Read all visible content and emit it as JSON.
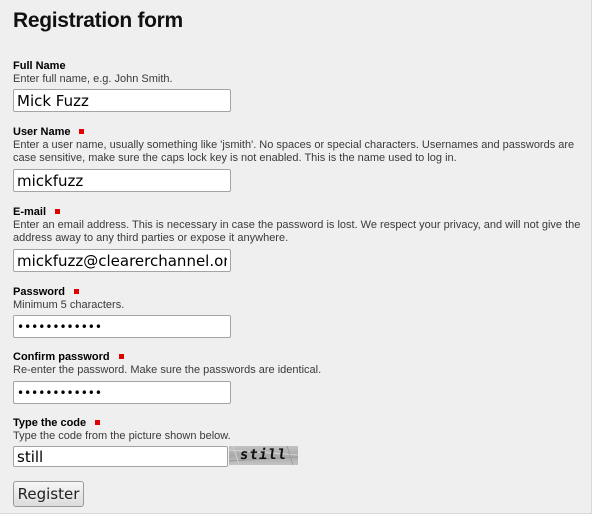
{
  "form": {
    "title": "Registration form",
    "required_marker_color": "#e00000",
    "fields": {
      "full_name": {
        "label": "Full Name",
        "hint": "Enter full name, e.g. John Smith.",
        "value": "Mick Fuzz"
      },
      "user_name": {
        "label": "User Name",
        "hint": "Enter a user name, usually something like 'jsmith'. No spaces or special characters. Usernames and passwords are case sensitive, make sure the caps lock key is not enabled. This is the name used to log in.",
        "value": "mickfuzz"
      },
      "email": {
        "label": "E-mail",
        "hint": "Enter an email address. This is necessary in case the password is lost. We respect your privacy, and will not give the address away to any third parties or expose it anywhere.",
        "value": "mickfuzz@clearerchannel.org"
      },
      "password": {
        "label": "Password",
        "hint": "Minimum 5 characters.",
        "value": "••••••••••••"
      },
      "confirm_password": {
        "label": "Confirm password",
        "hint": "Re-enter the password. Make sure the passwords are identical.",
        "value": "••••••••••••"
      },
      "code": {
        "label": "Type the code",
        "hint": "Type the code from the picture shown below.",
        "value": "still",
        "captcha_text": "still"
      }
    },
    "register_label": "Register"
  }
}
